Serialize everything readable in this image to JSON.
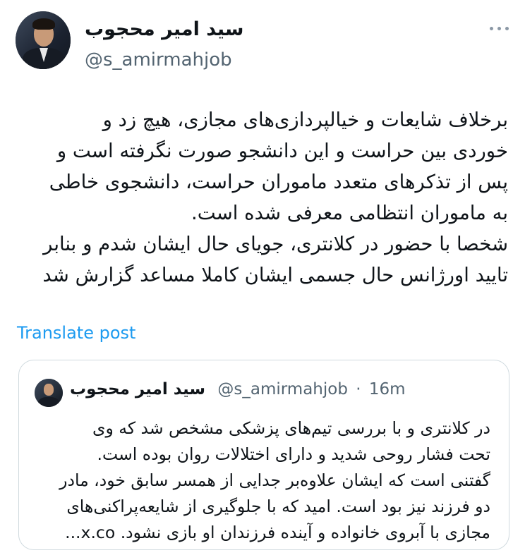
{
  "author": {
    "name": "سید امیر محجوب",
    "handle": "@s_amirmahjob"
  },
  "tweet": {
    "text": "برخلاف شایعات و خیالپردازی‌های مجازی، هیچ زد و\nخوردی بین حراست و این دانشجو صورت نگرفته است و\nپس از تذکرهای متعدد ماموران حراست، دانشجوی خاطی\nبه ماموران انتظامی معرفی شده است.\nشخصا با حضور در کلانتری، جویای حال ایشان شدم و بنابر\nتایید اورژانس حال جسمی ایشان کاملا مساعد گزارش شد",
    "translate_label": "Translate post"
  },
  "quote": {
    "name": "سید امیر محجوب",
    "handle": "@s_amirmahjob",
    "separator": "·",
    "time": "16m",
    "text": "در کلانتری و با بررسی تیم‌های پزشکی مشخص شد که وی\nتحت فشار روحی شدید و دارای اختلالات روان بوده است.\nگفتنی است که ایشان علاوه‌بر جدایی از همسر سابق خود، مادر\nدو فرزند نیز بود است. امید که با جلوگیری از شایعه‌پراکنی‌های\nمجازی با آبروی خانواده و آینده فرزندان او بازی نشود. x.co..."
  },
  "icons": {
    "more": "more-horizontal-icon"
  },
  "colors": {
    "accent": "#1d9bf0",
    "muted": "#536471",
    "border": "#cfd9de"
  }
}
